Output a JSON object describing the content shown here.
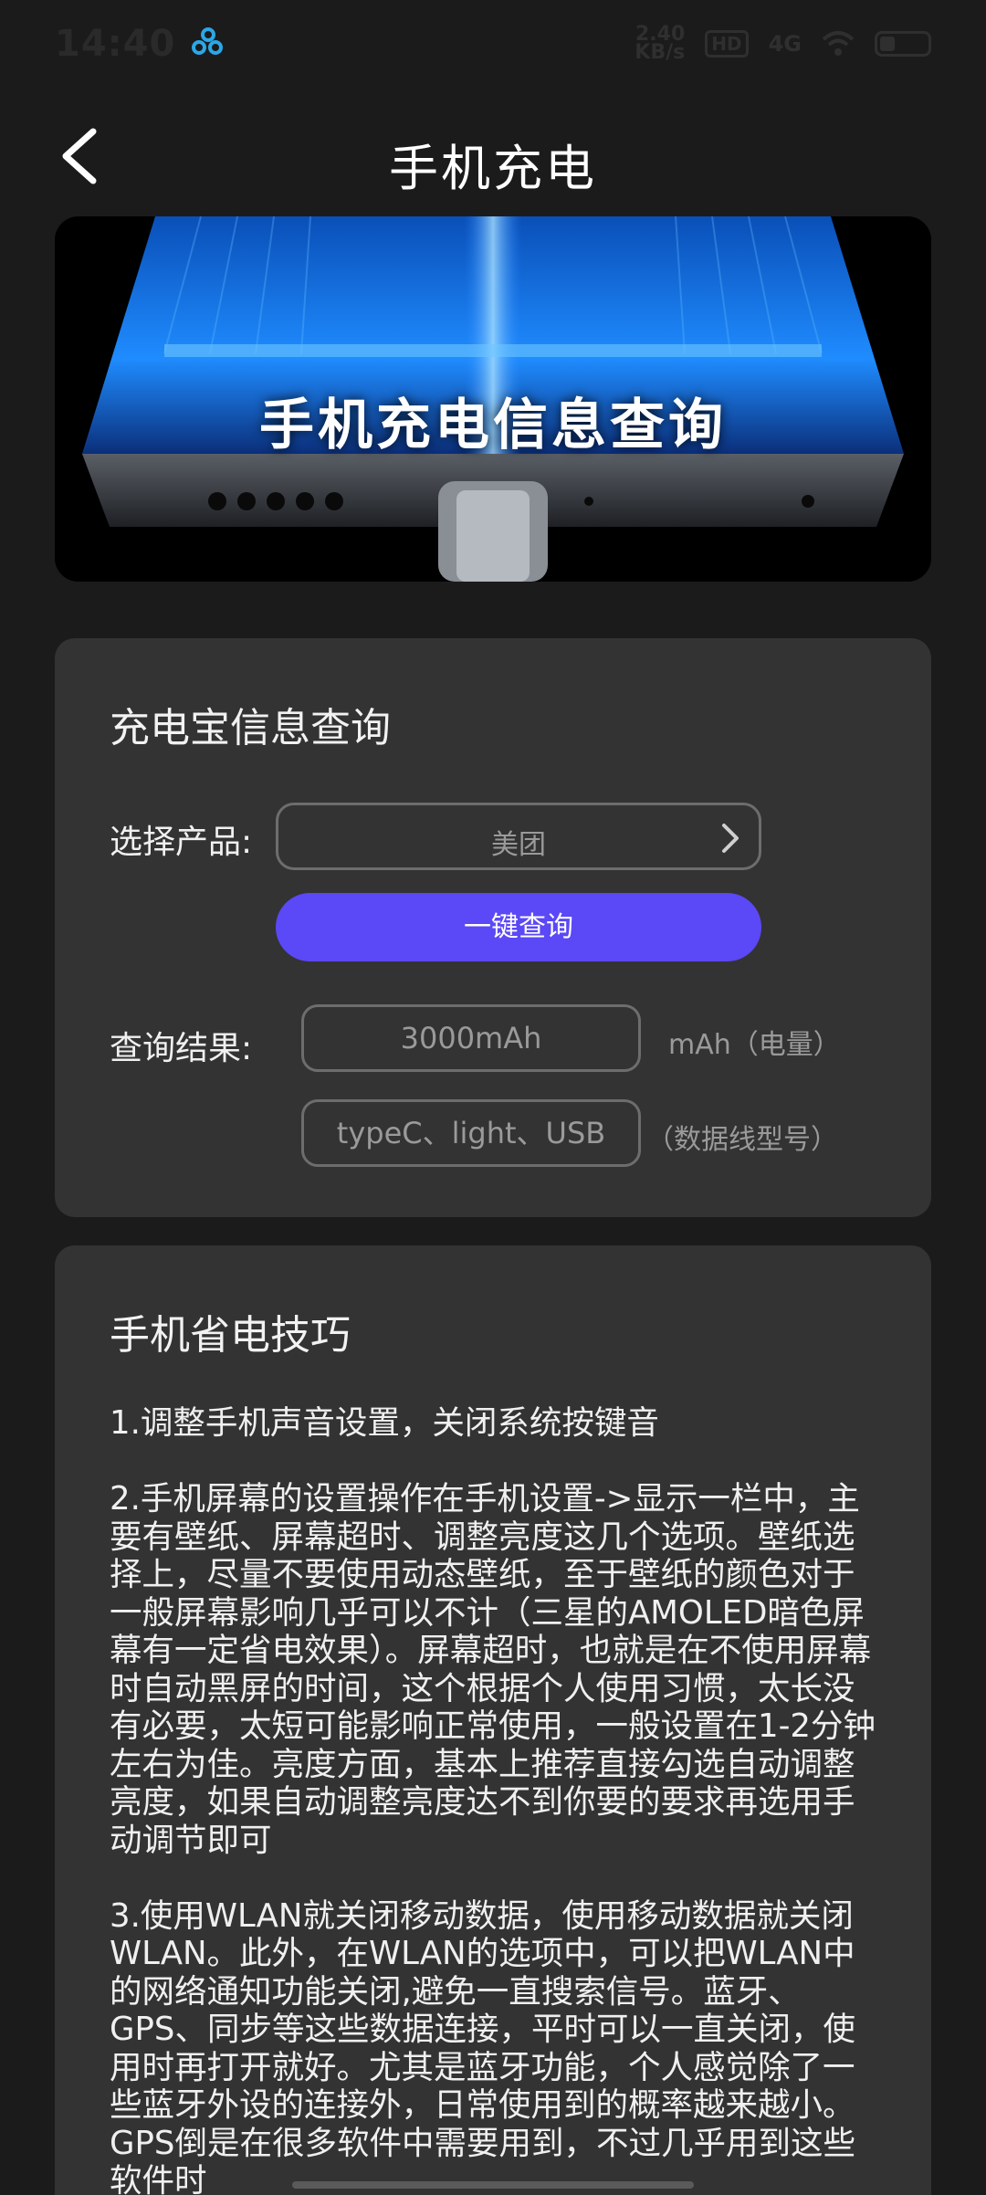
{
  "status_bar": {
    "time": "14:40",
    "net_speed_value": "2.40",
    "net_speed_unit": "KB/s",
    "hd_label": "HD",
    "signal_label": "4G"
  },
  "header": {
    "title": "手机充电"
  },
  "banner": {
    "title": "手机充电信息查询"
  },
  "query_card": {
    "title": "充电宝信息查询",
    "product_label": "选择产品:",
    "product_value": "美团",
    "query_button_label": "一键查询",
    "result_label": "查询结果:",
    "capacity_value": "3000mAh",
    "capacity_note": "mAh（电量）",
    "cable_value": "typeC、light、USB",
    "cable_note": "（数据线型号）"
  },
  "tips_card": {
    "title": "手机省电技巧",
    "paragraphs": [
      "1.调整手机声音设置，关闭系统按键音",
      "2.手机屏幕的设置操作在手机设置->显示一栏中，主要有壁纸、屏幕超时、调整亮度这几个选项。壁纸选择上，尽量不要使用动态壁纸，至于壁纸的颜色对于一般屏幕影响几乎可以不计（三星的AMOLED暗色屏幕有一定省电效果）。屏幕超时，也就是在不使用屏幕时自动黑屏的时间，这个根据个人使用习惯，太长没有必要，太短可能影响正常使用，一般设置在1-2分钟左右为佳。亮度方面，基本上推荐直接勾选自动调整亮度，如果自动调整亮度达不到你要的要求再选用手动调节即可",
      "3.使用WLAN就关闭移动数据，使用移动数据就关闭WLAN。此外，在WLAN的选项中，可以把WLAN中的网络通知功能关闭,避免一直搜索信号。蓝牙、GPS、同步等这些数据连接，平时可以一直关闭，使用时再打开就好。尤其是蓝牙功能，个人感觉除了一些蓝牙外设的连接外，日常使用到的概率越来越小。GPS倒是在很多软件中需要用到，不过几乎用到这些软件时"
    ]
  },
  "colors": {
    "background": "#1b1b1b",
    "card": "#333333",
    "accent_button": "#5b48f6",
    "placeholder_text": "#9a9a9a"
  },
  "icons": {
    "back": "chevron-left-icon",
    "select": "chevron-right-icon",
    "app": "app-notification-icon"
  }
}
